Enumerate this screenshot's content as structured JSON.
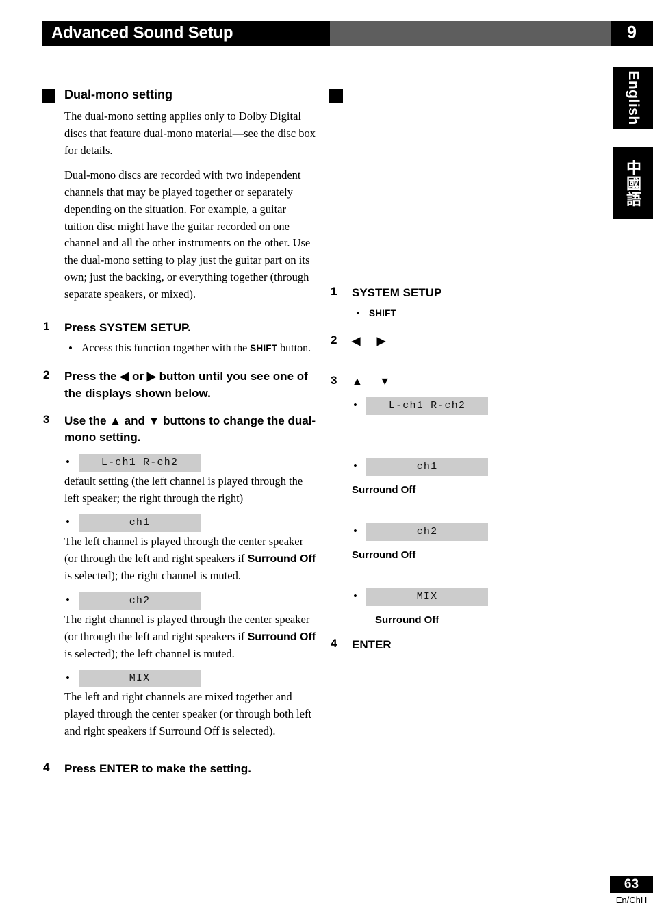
{
  "header": {
    "title": "Advanced Sound Setup",
    "chapter": "9"
  },
  "side_tabs": {
    "english": "English",
    "chinese": "中國語"
  },
  "left_column": {
    "section_title": "Dual-mono setting",
    "paragraphs": [
      "The dual-mono  setting applies only to Dolby Digital discs that feature dual-mono material—see the disc box for details.",
      "Dual-mono discs are recorded with two independent channels that may be played together or separately depending on the situation. For example, a guitar tuition disc might have the guitar recorded on one channel and all the other instruments on the other. Use the dual-mono setting to play just the guitar part on its own; just the backing, or everything together (through separate speakers, or mixed)."
    ],
    "steps": [
      {
        "num": "1",
        "text": "Press SYSTEM SETUP.",
        "bullet_prefix": "Access this function together with the ",
        "bullet_bold": "SHIFT",
        "bullet_suffix": " button."
      },
      {
        "num": "2",
        "text": "Press the ◀ or ▶ button until you see one of the displays shown below."
      },
      {
        "num": "3",
        "text": "Use the ▲ and ▼ buttons to change the dual-mono setting."
      },
      {
        "num": "4",
        "text": "Press ENTER to make the setting."
      }
    ],
    "displays": [
      {
        "label": "L-ch1  R-ch2",
        "desc_plain": "default setting (the left channel is played through the left speaker; the right through the right)"
      },
      {
        "label": "ch1",
        "desc_a": "The left channel is played through the center speaker (or through the left and right speakers if ",
        "desc_bold": "Surround Off",
        "desc_b": " is selected); the right channel is muted."
      },
      {
        "label": "ch2",
        "desc_a": "The right channel is played through the center speaker (or through the left and right speakers if ",
        "desc_bold": "Surround Off",
        "desc_b": " is selected); the left channel is muted."
      },
      {
        "label": "MIX",
        "desc_plain": "The left and right channels are mixed together and played through the center speaker (or through both left and right speakers if Surround Off is selected)."
      }
    ]
  },
  "right_column": {
    "section_title": "",
    "steps": [
      {
        "num": "1",
        "text": "SYSTEM SETUP",
        "bullet": "SHIFT"
      },
      {
        "num": "2",
        "text": "◀  ▶"
      },
      {
        "num": "3",
        "text": "▲  ▼"
      },
      {
        "num": "4",
        "text": "ENTER"
      }
    ],
    "displays": [
      {
        "label": "L-ch1  R-ch2",
        "note": ""
      },
      {
        "label": "ch1",
        "note": "Surround Off"
      },
      {
        "label": "ch2",
        "note": "Surround Off"
      },
      {
        "label": "MIX",
        "note": "Surround Off"
      }
    ]
  },
  "footer": {
    "page_number": "63",
    "language_code": "En/ChH"
  }
}
